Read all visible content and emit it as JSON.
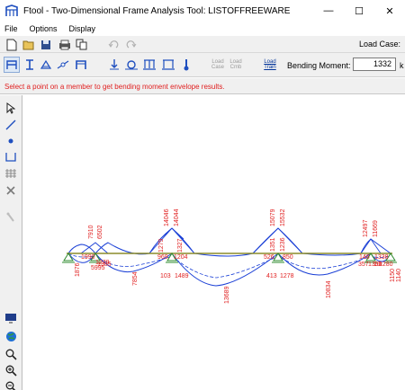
{
  "window": {
    "title": "Ftool - Two-Dimensional Frame Analysis Tool: LISTOFFREEWARE",
    "minimize": "—",
    "maximize": "☐",
    "close": "✕"
  },
  "menu": [
    "File",
    "Options",
    "Display"
  ],
  "toolbar": {
    "load_case_label": "Load Case:"
  },
  "toolbar2": {
    "load_case_l1": "Load",
    "load_case_l2": "Case",
    "load_cmb_l1": "Load",
    "load_cmb_l2": "Cmb",
    "load_train_l1": "Load",
    "load_train_l2": "Train",
    "bending_moment_label": "Bending Moment:",
    "bending_moment_value": "1332",
    "bending_moment_unit": "k"
  },
  "status": {
    "message": "Select a point on a member to get bending moment envelope results."
  },
  "colors": {
    "status_text": "#e02020",
    "beam": "#8b8b2a",
    "envelope": "#1a3fd6",
    "labels": "#e02020",
    "supports": "#2e8b2e"
  },
  "diagram_labels": {
    "top": [
      "7910",
      "6502",
      "14046",
      "14044",
      "15079",
      "15532",
      "12497",
      "11669"
    ],
    "mid": [
      "1876",
      "1990",
      "1279",
      "5995",
      "1385",
      "969",
      "1204",
      "526",
      "850",
      "148",
      "1338",
      "1279",
      "1327",
      "1351",
      "1236",
      "1150",
      "1140",
      "1390",
      "1280"
    ],
    "bottom": [
      "7854",
      "103",
      "1489",
      "13689",
      "413",
      "1278",
      "10834",
      "357",
      "10"
    ]
  }
}
